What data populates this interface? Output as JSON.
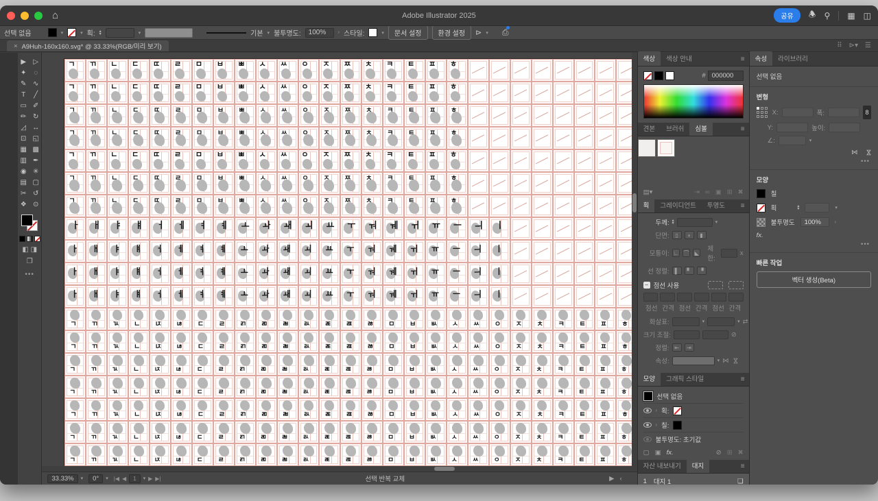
{
  "titlebar": {
    "title": "Adobe Illustrator 2025",
    "share_label": "공유"
  },
  "control_bar": {
    "selection_label": "선택 없음",
    "stroke_label": "획:",
    "line_style_label": "기본",
    "opacity_label": "불투명도:",
    "opacity_value": "100%",
    "style_label": "스타일:",
    "doc_setup_label": "문서 설정",
    "preferences_label": "환경 설정"
  },
  "document_tab": {
    "title": "A9Huh-160x160.svg* @ 33.33%(RGB/미리 보기)"
  },
  "left_toolbar": {
    "tools": [
      {
        "name": "selection",
        "glyph": "▶"
      },
      {
        "name": "direct-selection",
        "glyph": "▷"
      },
      {
        "name": "magic-wand",
        "glyph": "✦"
      },
      {
        "name": "lasso",
        "glyph": "◌"
      },
      {
        "name": "pen",
        "glyph": "✎"
      },
      {
        "name": "curvature",
        "glyph": "∿"
      },
      {
        "name": "type",
        "glyph": "T"
      },
      {
        "name": "line-segment",
        "glyph": "╱"
      },
      {
        "name": "rectangle",
        "glyph": "▭"
      },
      {
        "name": "paintbrush",
        "glyph": "✐"
      },
      {
        "name": "pencil",
        "glyph": "✏"
      },
      {
        "name": "rotate",
        "glyph": "↻"
      },
      {
        "name": "scale",
        "glyph": "◿"
      },
      {
        "name": "width",
        "glyph": "↔"
      },
      {
        "name": "free-transform",
        "glyph": "⊡"
      },
      {
        "name": "shape-builder",
        "glyph": "◱"
      },
      {
        "name": "perspective-grid",
        "glyph": "▦"
      },
      {
        "name": "mesh",
        "glyph": "▩"
      },
      {
        "name": "gradient",
        "glyph": "▥"
      },
      {
        "name": "eyedropper",
        "glyph": "✒"
      },
      {
        "name": "blend",
        "glyph": "◉"
      },
      {
        "name": "symbol-sprayer",
        "glyph": "✳"
      },
      {
        "name": "column-graph",
        "glyph": "▤"
      },
      {
        "name": "artboard",
        "glyph": "▢"
      },
      {
        "name": "slice",
        "glyph": "✂"
      },
      {
        "name": "rotate-view",
        "glyph": "↺"
      },
      {
        "name": "hand",
        "glyph": "❖"
      },
      {
        "name": "zoom",
        "glyph": "⊙"
      }
    ]
  },
  "canvas": {
    "columns": 27,
    "sets": {
      "consonants": [
        "ㄱ",
        "ㄲ",
        "ㄴ",
        "ㄷ",
        "ㄸ",
        "ㄹ",
        "ㅁ",
        "ㅂ",
        "ㅃ",
        "ㅅ",
        "ㅆ",
        "ㅇ",
        "ㅈ",
        "ㅉ",
        "ㅊ",
        "ㅋ",
        "ㅌ",
        "ㅍ",
        "ㅎ"
      ],
      "vowels": [
        "ㅏ",
        "ㅐ",
        "ㅑ",
        "ㅒ",
        "ㅓ",
        "ㅔ",
        "ㅕ",
        "ㅖ",
        "ㅗ",
        "ㅘ",
        "ㅙ",
        "ㅚ",
        "ㅛ",
        "ㅜ",
        "ㅝ",
        "ㅞ",
        "ㅟ",
        "ㅠ",
        "ㅡ",
        "ㅢ",
        "ㅣ"
      ],
      "finals": [
        "ㄱ",
        "ㄲ",
        "ㄳ",
        "ㄴ",
        "ㄵ",
        "ㄶ",
        "ㄷ",
        "ㄹ",
        "ㄺ",
        "ㄻ",
        "ㄼ",
        "ㄽ",
        "ㄾ",
        "ㄿ",
        "ㅀ",
        "ㅁ",
        "ㅂ",
        "ㅄ",
        "ㅅ",
        "ㅆ",
        "ㅇ",
        "ㅈ",
        "ㅊ",
        "ㅋ",
        "ㅌ",
        "ㅍ",
        "ㅎ"
      ]
    },
    "rows": [
      {
        "set": "consonants",
        "variant": "a"
      },
      {
        "set": "consonants",
        "variant": "a"
      },
      {
        "set": "consonants",
        "variant": "b"
      },
      {
        "set": "consonants",
        "variant": "b"
      },
      {
        "set": "consonants",
        "variant": "a"
      },
      {
        "set": "consonants",
        "variant": "b"
      },
      {
        "set": "consonants",
        "variant": "b"
      },
      {
        "set": "vowels",
        "variant": "a"
      },
      {
        "set": "vowels",
        "variant": "b"
      },
      {
        "set": "vowels",
        "variant": "b"
      },
      {
        "set": "vowels",
        "variant": "b"
      },
      {
        "set": "finals",
        "variant": "a"
      },
      {
        "set": "finals",
        "variant": "a"
      },
      {
        "set": "finals",
        "variant": "b"
      },
      {
        "set": "finals",
        "variant": "b"
      },
      {
        "set": "finals",
        "variant": "a"
      },
      {
        "set": "finals",
        "variant": "b"
      },
      {
        "set": "finals",
        "variant": "b"
      },
      {
        "set": "finals",
        "variant": "a"
      }
    ]
  },
  "status_bar": {
    "zoom": "33.33%",
    "rotation": "0°",
    "artboard_number": "1",
    "hint": "선택 반복 교체"
  },
  "color_panel": {
    "tab_color": "색상",
    "tab_guide": "색상 안내",
    "hex_label": "#",
    "hex_value": "000000"
  },
  "library_tabs": {
    "swatches": "견본",
    "brushes": "브러쉬",
    "symbols": "심볼"
  },
  "stroke_panel": {
    "tab_stroke": "획",
    "tab_gradient": "그레이디언트",
    "tab_transparency": "투명도",
    "weight_label": "두께:",
    "cap_label": "단면:",
    "corner_label": "모퉁이:",
    "limit_label": "제한:",
    "align_label": "선 정렬:",
    "dashed_label": "점선 사용",
    "dash_label": "점선",
    "gap_label": "간격",
    "arrow_label": "화살표:",
    "scale_label": "크기 조절:",
    "align2_label": "정렬:",
    "profile_label": "속성:"
  },
  "appearance_panel": {
    "tab_appearance": "모양",
    "tab_styles": "그래픽 스타일",
    "no_selection": "선택 없음",
    "stroke_label": "획:",
    "fill_label": "칠:",
    "opacity_row": "불투명도: 초기값",
    "fx_label": "fx."
  },
  "artboard_panel": {
    "tab_assets": "자산 내보내기",
    "tab_artboards": "대지",
    "row_number": "1",
    "row_name": "대지 1"
  },
  "properties": {
    "tab_properties": "속성",
    "tab_libraries": "라이브러리",
    "no_selection": "선택 없음",
    "transform_title": "변형",
    "x_label": "X:",
    "y_label": "Y:",
    "w_label": "폭:",
    "h_label": "높이:",
    "angle_label": "∠:",
    "appearance_title": "모양",
    "fill_label": "칠",
    "stroke_label": "획",
    "opacity_label": "불투명도",
    "opacity_value": "100%",
    "fx_label": "fx.",
    "quick_title": "빠른 작업",
    "vector_button": "벡터 생성(Beta)"
  }
}
